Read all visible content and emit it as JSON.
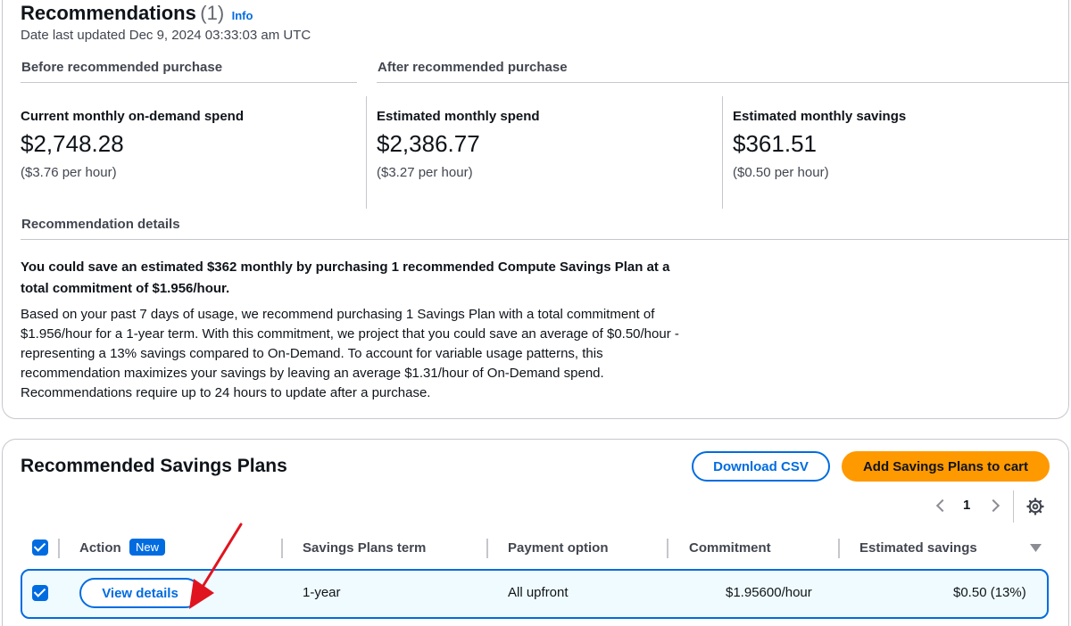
{
  "recommendations": {
    "title": "Recommendations",
    "count": "(1)",
    "info_link": "Info",
    "date_updated": "Date last updated Dec 9, 2024 03:33:03 am UTC",
    "before_heading": "Before recommended purchase",
    "after_heading": "After recommended purchase",
    "metrics": [
      {
        "label": "Current monthly on-demand spend",
        "value": "$2,748.28",
        "sub": "($3.76 per hour)"
      },
      {
        "label": "Estimated monthly spend",
        "value": "$2,386.77",
        "sub": "($3.27 per hour)"
      },
      {
        "label": "Estimated monthly savings",
        "value": "$361.51",
        "sub": "($0.50 per hour)"
      }
    ],
    "details_heading": "Recommendation details",
    "summary": "You could save an estimated $362 monthly by purchasing 1 recommended Compute Savings Plan at a total commitment of $1.956/hour.",
    "description": "Based on your past 7 days of usage, we recommend purchasing 1 Savings Plan with a total commitment of $1.956/hour for a 1-year term. With this commitment, we project that you could save an average of $0.50/hour - representing a 13% savings compared to On-Demand. To account for variable usage patterns, this recommendation maximizes your savings by leaving an average $1.31/hour of On-Demand spend. Recommendations require up to 24 hours to update after a purchase."
  },
  "plans": {
    "title": "Recommended Savings Plans",
    "download_csv": "Download CSV",
    "add_to_cart": "Add Savings Plans to cart",
    "page_number": "1",
    "columns": {
      "action": "Action",
      "new_badge": "New",
      "term": "Savings Plans term",
      "payment": "Payment option",
      "commitment": "Commitment",
      "savings": "Estimated savings"
    },
    "rows": [
      {
        "action": "View details",
        "term": "1-year",
        "payment": "All upfront",
        "commitment": "$1.95600/hour",
        "savings": "$0.50 (13%)"
      }
    ]
  },
  "colors": {
    "accent": "#006ce0",
    "primary_button": "#ff9900",
    "annotation_arrow": "#e0141e"
  }
}
